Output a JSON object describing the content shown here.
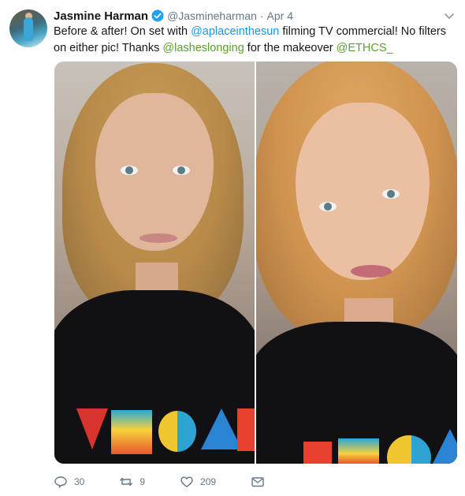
{
  "tweet": {
    "author_name": "Jasmine Harman",
    "handle": "@Jasmineharman",
    "separator": "·",
    "date": "Apr 4",
    "text_parts": {
      "p1": "Before & after! On set with ",
      "m1": "@aplaceinthesun",
      "p2": " filming TV commercial! No filters on either pic! Thanks ",
      "m2": "@lasheslonging",
      "p3": " for the makeover ",
      "m3": "@ETHCS_"
    }
  },
  "actions": {
    "replies": "30",
    "retweets": "9",
    "likes": "209"
  },
  "icons": [
    "verified-icon",
    "chevron-down-icon",
    "reply-icon",
    "retweet-icon",
    "like-icon",
    "message-icon"
  ],
  "colors": {
    "link_blue": "#1b95e0",
    "link_green": "#5aa02c",
    "muted": "#657786",
    "verified": "#1da1f2"
  }
}
